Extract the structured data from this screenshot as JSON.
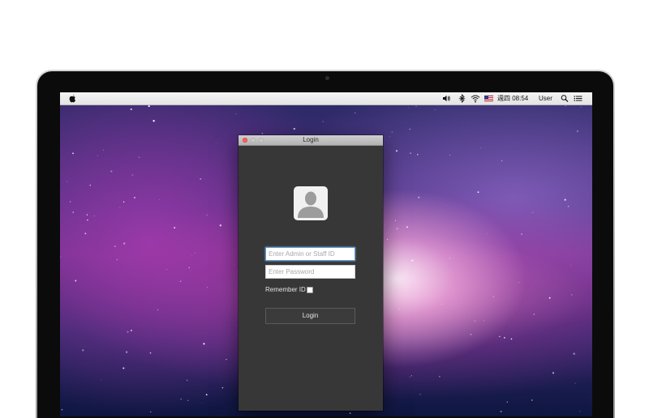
{
  "menubar": {
    "clock": "週四 08:54",
    "user": "User",
    "icons": [
      "apple-icon",
      "volume-icon",
      "bluetooth-icon",
      "wifi-icon",
      "us-flag-icon",
      "search-icon",
      "notification-list-icon"
    ]
  },
  "login_window": {
    "title": "Login",
    "id_placeholder": "Enter Admin or Staff ID",
    "password_placeholder": "Enter Password",
    "remember_label": "Remember ID",
    "remember_checked": false,
    "login_button_label": "Login",
    "avatar_icon": "user-silhouette-icon"
  },
  "colors": {
    "window_bg": "#373737",
    "focus_ring": "#5b9bd9",
    "close_button": "#fb5f57"
  }
}
